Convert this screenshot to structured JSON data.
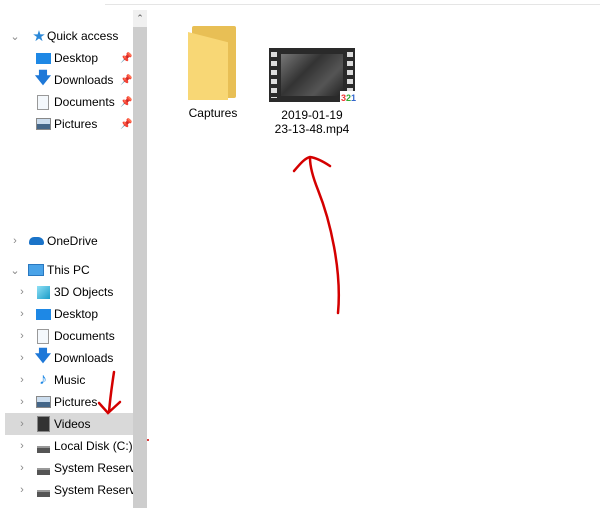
{
  "nav": {
    "quick_access": {
      "label": "Quick access",
      "icon": "star-icon",
      "items": [
        {
          "label": "Desktop",
          "icon": "desktop-icon"
        },
        {
          "label": "Downloads",
          "icon": "download-icon"
        },
        {
          "label": "Documents",
          "icon": "documents-icon"
        },
        {
          "label": "Pictures",
          "icon": "pictures-icon"
        }
      ]
    },
    "onedrive": {
      "label": "OneDrive",
      "icon": "cloud-icon"
    },
    "this_pc": {
      "label": "This PC",
      "icon": "computer-icon",
      "items": [
        {
          "label": "3D Objects",
          "icon": "cube-icon"
        },
        {
          "label": "Desktop",
          "icon": "desktop-icon"
        },
        {
          "label": "Documents",
          "icon": "documents-icon"
        },
        {
          "label": "Downloads",
          "icon": "download-icon"
        },
        {
          "label": "Music",
          "icon": "music-icon"
        },
        {
          "label": "Pictures",
          "icon": "pictures-icon"
        },
        {
          "label": "Videos",
          "icon": "videos-icon",
          "selected": true
        },
        {
          "label": "Local Disk (C:)",
          "icon": "drive-icon"
        },
        {
          "label": "System Reservec",
          "icon": "drive-icon"
        },
        {
          "label": "System Reservec",
          "icon": "drive-icon"
        }
      ]
    }
  },
  "files": [
    {
      "name": "Captures",
      "type": "folder"
    },
    {
      "name_line1": "2019-01-19",
      "name_line2": "23-13-48.mp4",
      "type": "video"
    }
  ],
  "colors": {
    "selection": "#d9d9d9",
    "annotation": "#d40000",
    "accent": "#1e88e5",
    "folder": "#f8d775"
  }
}
